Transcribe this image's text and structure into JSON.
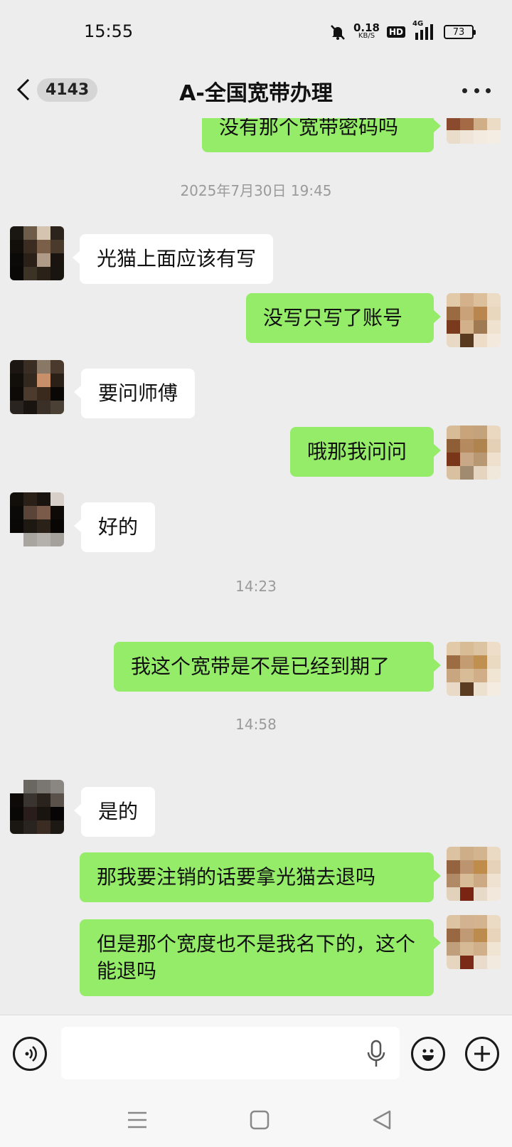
{
  "status_bar": {
    "time": "15:55",
    "speed_value": "0.18",
    "speed_unit": "KB/S",
    "hd": "HD",
    "network": "4G",
    "battery": "73"
  },
  "header": {
    "unread_count": "4143",
    "title": "A-全国宽带办理"
  },
  "messages": [
    {
      "type": "out",
      "text": "没有那个宽带密码吗"
    },
    {
      "type": "time",
      "text": "2025年7月30日 19:45"
    },
    {
      "type": "in",
      "text": "光猫上面应该有写"
    },
    {
      "type": "out",
      "text": "没写只写了账号"
    },
    {
      "type": "in",
      "text": "要问师傅"
    },
    {
      "type": "out",
      "text": "哦那我问问"
    },
    {
      "type": "in",
      "text": "好的"
    },
    {
      "type": "time",
      "text": "14:23"
    },
    {
      "type": "out",
      "text": "我这个宽带是不是已经到期了"
    },
    {
      "type": "time",
      "text": "14:58"
    },
    {
      "type": "in",
      "text": "是的"
    },
    {
      "type": "out",
      "text": "那我要注销的话要拿光猫去退吗"
    },
    {
      "type": "out",
      "text": "但是那个宽度也不是我名下的，这个能退吗"
    }
  ],
  "colors": {
    "outgoing_bubble": "#95ec69",
    "incoming_bubble": "#ffffff",
    "background": "#ededed"
  },
  "icons": {
    "input_left": "voice-mode-icon",
    "input_mic": "microphone-icon",
    "emoji": "emoji-icon",
    "plus": "plus-icon",
    "nav": [
      "menu-icon",
      "home-square-icon",
      "back-triangle-icon"
    ]
  }
}
